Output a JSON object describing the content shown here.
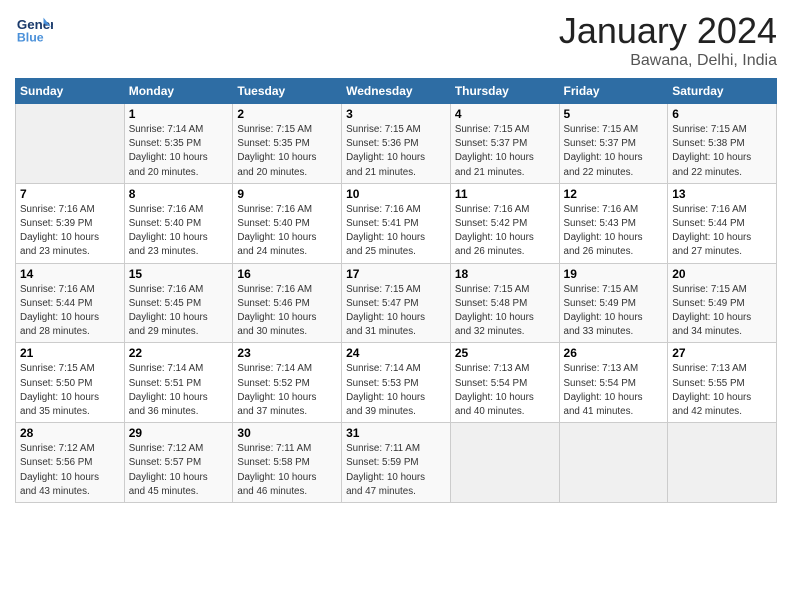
{
  "header": {
    "logo": {
      "line1": "General",
      "line2": "Blue"
    },
    "title": "January 2024",
    "subtitle": "Bawana, Delhi, India"
  },
  "days_of_week": [
    "Sunday",
    "Monday",
    "Tuesday",
    "Wednesday",
    "Thursday",
    "Friday",
    "Saturday"
  ],
  "weeks": [
    [
      {
        "day": "",
        "info": ""
      },
      {
        "day": "1",
        "info": "Sunrise: 7:14 AM\nSunset: 5:35 PM\nDaylight: 10 hours\nand 20 minutes."
      },
      {
        "day": "2",
        "info": "Sunrise: 7:15 AM\nSunset: 5:35 PM\nDaylight: 10 hours\nand 20 minutes."
      },
      {
        "day": "3",
        "info": "Sunrise: 7:15 AM\nSunset: 5:36 PM\nDaylight: 10 hours\nand 21 minutes."
      },
      {
        "day": "4",
        "info": "Sunrise: 7:15 AM\nSunset: 5:37 PM\nDaylight: 10 hours\nand 21 minutes."
      },
      {
        "day": "5",
        "info": "Sunrise: 7:15 AM\nSunset: 5:37 PM\nDaylight: 10 hours\nand 22 minutes."
      },
      {
        "day": "6",
        "info": "Sunrise: 7:15 AM\nSunset: 5:38 PM\nDaylight: 10 hours\nand 22 minutes."
      }
    ],
    [
      {
        "day": "7",
        "info": "Sunrise: 7:16 AM\nSunset: 5:39 PM\nDaylight: 10 hours\nand 23 minutes."
      },
      {
        "day": "8",
        "info": "Sunrise: 7:16 AM\nSunset: 5:40 PM\nDaylight: 10 hours\nand 23 minutes."
      },
      {
        "day": "9",
        "info": "Sunrise: 7:16 AM\nSunset: 5:40 PM\nDaylight: 10 hours\nand 24 minutes."
      },
      {
        "day": "10",
        "info": "Sunrise: 7:16 AM\nSunset: 5:41 PM\nDaylight: 10 hours\nand 25 minutes."
      },
      {
        "day": "11",
        "info": "Sunrise: 7:16 AM\nSunset: 5:42 PM\nDaylight: 10 hours\nand 26 minutes."
      },
      {
        "day": "12",
        "info": "Sunrise: 7:16 AM\nSunset: 5:43 PM\nDaylight: 10 hours\nand 26 minutes."
      },
      {
        "day": "13",
        "info": "Sunrise: 7:16 AM\nSunset: 5:44 PM\nDaylight: 10 hours\nand 27 minutes."
      }
    ],
    [
      {
        "day": "14",
        "info": "Sunrise: 7:16 AM\nSunset: 5:44 PM\nDaylight: 10 hours\nand 28 minutes."
      },
      {
        "day": "15",
        "info": "Sunrise: 7:16 AM\nSunset: 5:45 PM\nDaylight: 10 hours\nand 29 minutes."
      },
      {
        "day": "16",
        "info": "Sunrise: 7:16 AM\nSunset: 5:46 PM\nDaylight: 10 hours\nand 30 minutes."
      },
      {
        "day": "17",
        "info": "Sunrise: 7:15 AM\nSunset: 5:47 PM\nDaylight: 10 hours\nand 31 minutes."
      },
      {
        "day": "18",
        "info": "Sunrise: 7:15 AM\nSunset: 5:48 PM\nDaylight: 10 hours\nand 32 minutes."
      },
      {
        "day": "19",
        "info": "Sunrise: 7:15 AM\nSunset: 5:49 PM\nDaylight: 10 hours\nand 33 minutes."
      },
      {
        "day": "20",
        "info": "Sunrise: 7:15 AM\nSunset: 5:49 PM\nDaylight: 10 hours\nand 34 minutes."
      }
    ],
    [
      {
        "day": "21",
        "info": "Sunrise: 7:15 AM\nSunset: 5:50 PM\nDaylight: 10 hours\nand 35 minutes."
      },
      {
        "day": "22",
        "info": "Sunrise: 7:14 AM\nSunset: 5:51 PM\nDaylight: 10 hours\nand 36 minutes."
      },
      {
        "day": "23",
        "info": "Sunrise: 7:14 AM\nSunset: 5:52 PM\nDaylight: 10 hours\nand 37 minutes."
      },
      {
        "day": "24",
        "info": "Sunrise: 7:14 AM\nSunset: 5:53 PM\nDaylight: 10 hours\nand 39 minutes."
      },
      {
        "day": "25",
        "info": "Sunrise: 7:13 AM\nSunset: 5:54 PM\nDaylight: 10 hours\nand 40 minutes."
      },
      {
        "day": "26",
        "info": "Sunrise: 7:13 AM\nSunset: 5:54 PM\nDaylight: 10 hours\nand 41 minutes."
      },
      {
        "day": "27",
        "info": "Sunrise: 7:13 AM\nSunset: 5:55 PM\nDaylight: 10 hours\nand 42 minutes."
      }
    ],
    [
      {
        "day": "28",
        "info": "Sunrise: 7:12 AM\nSunset: 5:56 PM\nDaylight: 10 hours\nand 43 minutes."
      },
      {
        "day": "29",
        "info": "Sunrise: 7:12 AM\nSunset: 5:57 PM\nDaylight: 10 hours\nand 45 minutes."
      },
      {
        "day": "30",
        "info": "Sunrise: 7:11 AM\nSunset: 5:58 PM\nDaylight: 10 hours\nand 46 minutes."
      },
      {
        "day": "31",
        "info": "Sunrise: 7:11 AM\nSunset: 5:59 PM\nDaylight: 10 hours\nand 47 minutes."
      },
      {
        "day": "",
        "info": ""
      },
      {
        "day": "",
        "info": ""
      },
      {
        "day": "",
        "info": ""
      }
    ]
  ]
}
